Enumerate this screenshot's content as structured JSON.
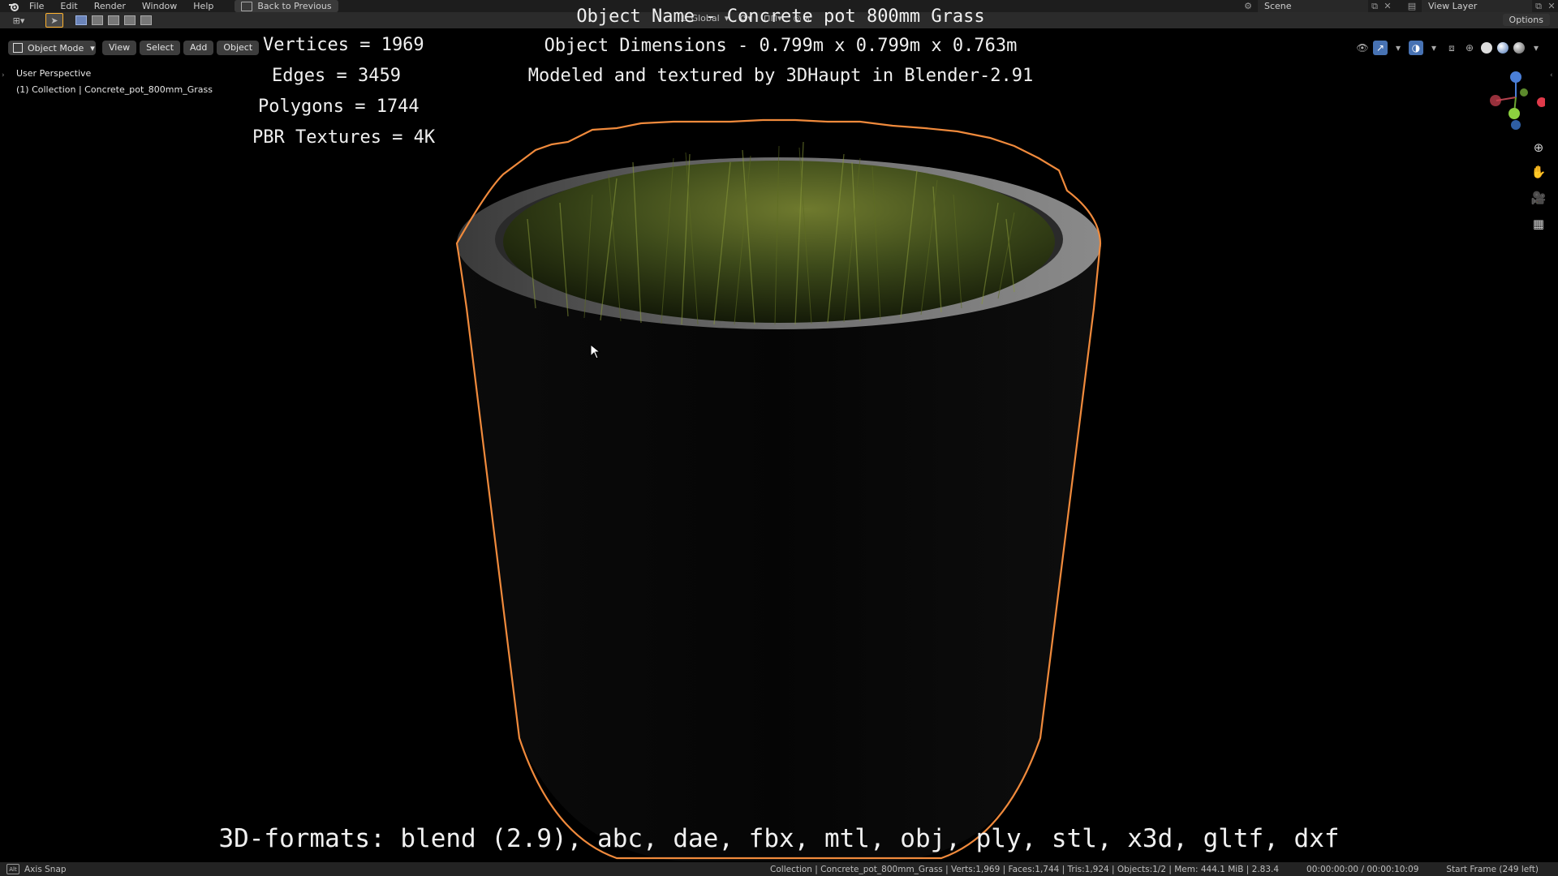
{
  "menu": {
    "items": [
      "File",
      "Edit",
      "Render",
      "Window",
      "Help"
    ],
    "back_button": "Back to Previous",
    "scene": "Scene",
    "view_layer": "View Layer"
  },
  "tool_header": {
    "orientation": "Global",
    "options": "Options"
  },
  "view_header": {
    "mode": "Object Mode",
    "menus": [
      "View",
      "Select",
      "Add",
      "Object"
    ]
  },
  "viewport": {
    "perspective": "User Perspective",
    "collection": "(1) Collection | Concrete_pot_800mm_Grass"
  },
  "overlay": {
    "object_name": "Object Name - Concrete pot 800mm Grass",
    "dimensions": "Object Dimensions -  0.799m x 0.799m x 0.763m",
    "credit": "Modeled and textured by 3DHaupt in Blender-2.91",
    "vertices": "Vertices = 1969",
    "edges": "Edges = 3459",
    "polygons": "Polygons = 1744",
    "textures": "PBR Textures = 4K",
    "formats": "3D-formats: blend (2.9), abc, dae, fbx, mtl, obj, ply, stl, x3d, gltf, dxf"
  },
  "status": {
    "key_hint": "Alt",
    "axis_snap": "Axis Snap",
    "scene_stats": "Collection | Concrete_pot_800mm_Grass | Verts:1,969 | Faces:1,744 | Tris:1,924 | Objects:1/2 | Mem: 444.1 MiB | 2.83.4",
    "time": "00:00:00:00 / 00:00:10:09",
    "frame": "Start Frame (249 left)"
  },
  "colors": {
    "selection_outline": "#f08a3c",
    "active_tool": "#ffb22e",
    "accent_blue": "#4772b3"
  }
}
